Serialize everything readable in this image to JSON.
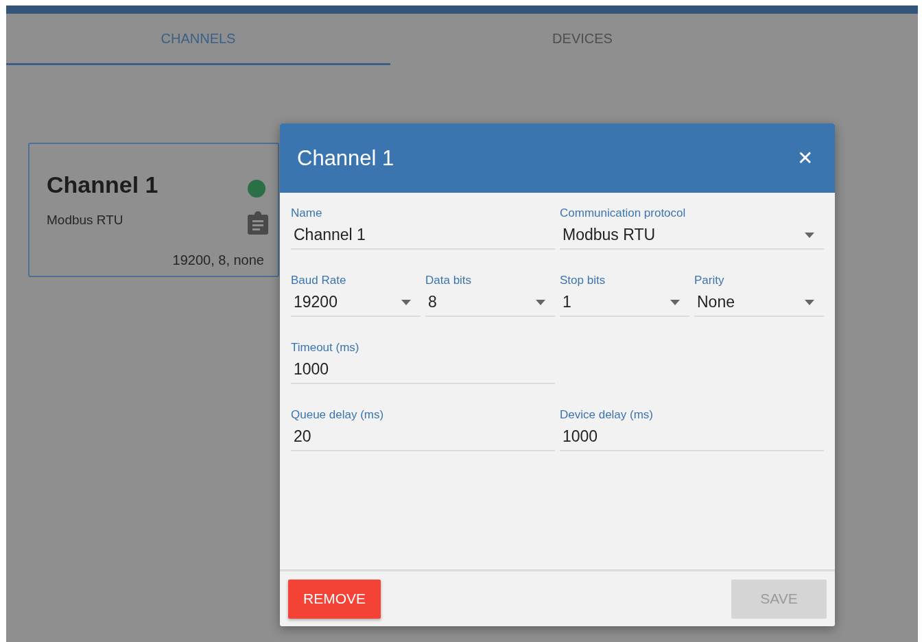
{
  "tabs": [
    {
      "label": "CHANNELS",
      "selected": true
    },
    {
      "label": "DEVICES",
      "selected": false
    }
  ],
  "channel_card": {
    "title": "Channel 1",
    "color": "#2b6f47",
    "protocol": "Modbus RTU",
    "settings": "19200, 8, none"
  },
  "dialog": {
    "title": "Channel 1",
    "close": "✕",
    "rows": [
      [
        {
          "label": "Name",
          "value": "Channel 1",
          "kind": "text"
        },
        {
          "label": "Communication protocol",
          "value": "Modbus RTU",
          "kind": "select"
        }
      ],
      [
        {
          "label": "Baud Rate",
          "value": "19200",
          "kind": "select"
        },
        {
          "label": "Data bits",
          "value": "8",
          "kind": "select"
        },
        {
          "label": "Stop bits",
          "value": "1",
          "kind": "select"
        },
        {
          "label": "Parity",
          "value": "None",
          "kind": "select"
        }
      ],
      [
        {
          "label": "Timeout (ms)",
          "value": "1000",
          "kind": "text"
        }
      ],
      [
        {
          "label": "Queue delay (ms)",
          "value": "20",
          "kind": "text"
        },
        {
          "label": "Device delay (ms)",
          "value": "1000",
          "kind": "text"
        }
      ]
    ],
    "buttons": [
      {
        "label": "REMOVE",
        "kind": "danger",
        "disabled": false
      },
      {
        "label": "SAVE",
        "kind": "primary",
        "disabled": true
      }
    ]
  }
}
